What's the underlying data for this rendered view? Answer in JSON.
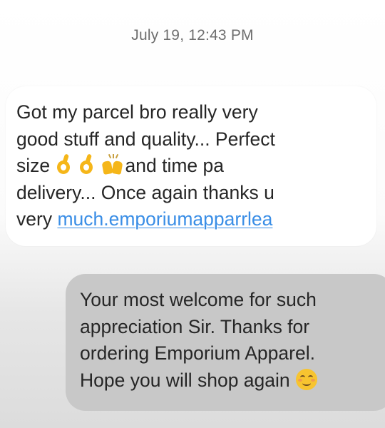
{
  "conversation": {
    "timestamp": "July 19, 12:43 PM",
    "received_message": {
      "line1": "Got my parcel bro really very",
      "line2": "good stuff and quality... Perfect",
      "line3_start": "size",
      "line3_end": "and time pa",
      "line4": "delivery... Once again thanks u",
      "line5_start": "very",
      "link_text": "much.emporiumapparrlea",
      "emojis": [
        "ok-hand",
        "ok-hand",
        "raised-hands"
      ]
    },
    "sent_message": {
      "line1": "Your most welcome for such",
      "line2": "appreciation Sir. Thanks for",
      "line3": "ordering Emporium Apparel.",
      "line4": "Hope you will shop again",
      "emoji": "smiling-face-with-smiling-eyes"
    }
  },
  "colors": {
    "link": "#3a8ee6",
    "received_bubble": "#ffffff",
    "sent_bubble": "#c8c8c8",
    "timestamp": "#6e6e6e",
    "emoji_yellow": "#f5b619"
  }
}
